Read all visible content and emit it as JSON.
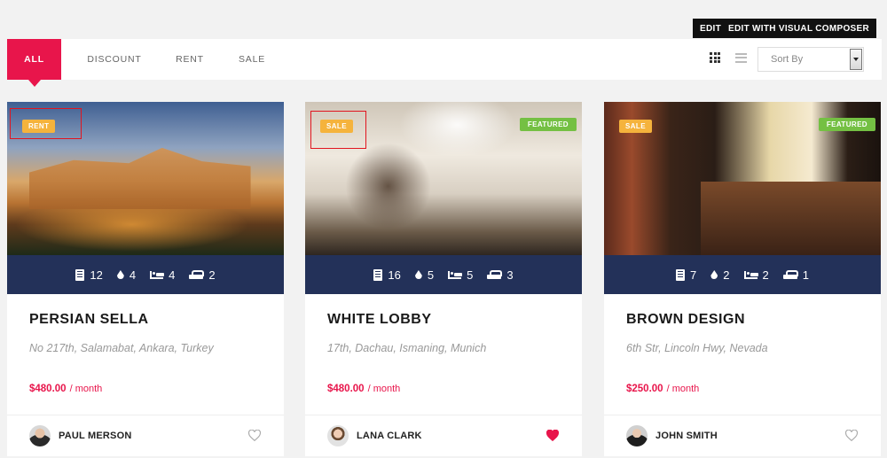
{
  "edit_bar": {
    "edit_label": "EDIT",
    "visual_composer_label": "EDIT WITH VISUAL COMPOSER"
  },
  "filters": {
    "tabs": [
      {
        "label": "ALL",
        "active": true
      },
      {
        "label": "DISCOUNT",
        "active": false
      },
      {
        "label": "RENT",
        "active": false
      },
      {
        "label": "SALE",
        "active": false
      }
    ],
    "view_modes": [
      "grid-icon",
      "list-icon"
    ],
    "sort": {
      "placeholder": "Sort By"
    }
  },
  "listings": [
    {
      "status": "RENT",
      "featured": false,
      "stats": {
        "rooms": "12",
        "baths": "4",
        "beds": "4",
        "garages": "2"
      },
      "title": "PERSIAN SELLA",
      "address": "No 217th, Salamabat, Ankara, Turkey",
      "price": "$480.00",
      "period": "/ month",
      "agent": "PAUL MERSON",
      "favorited": false
    },
    {
      "status": "SALE",
      "featured": true,
      "featured_label": "FEATURED",
      "stats": {
        "rooms": "16",
        "baths": "5",
        "beds": "5",
        "garages": "3"
      },
      "title": "WHITE LOBBY",
      "address": "17th, Dachau, Ismaning, Munich",
      "price": "$480.00",
      "period": "/ month",
      "agent": "LANA CLARK",
      "favorited": true
    },
    {
      "status": "SALE",
      "featured": true,
      "featured_label": "FEATURED",
      "stats": {
        "rooms": "7",
        "baths": "2",
        "beds": "2",
        "garages": "1"
      },
      "title": "BROWN DESIGN",
      "address": "6th Str, Lincoln Hwy, Nevada",
      "price": "$250.00",
      "period": "/ month",
      "agent": "JOHN SMITH",
      "favorited": false
    }
  ],
  "colors": {
    "accent": "#e8154b",
    "stats_bar": "#233159",
    "status_badge": "#f5b33c",
    "featured_badge": "#74c043"
  }
}
